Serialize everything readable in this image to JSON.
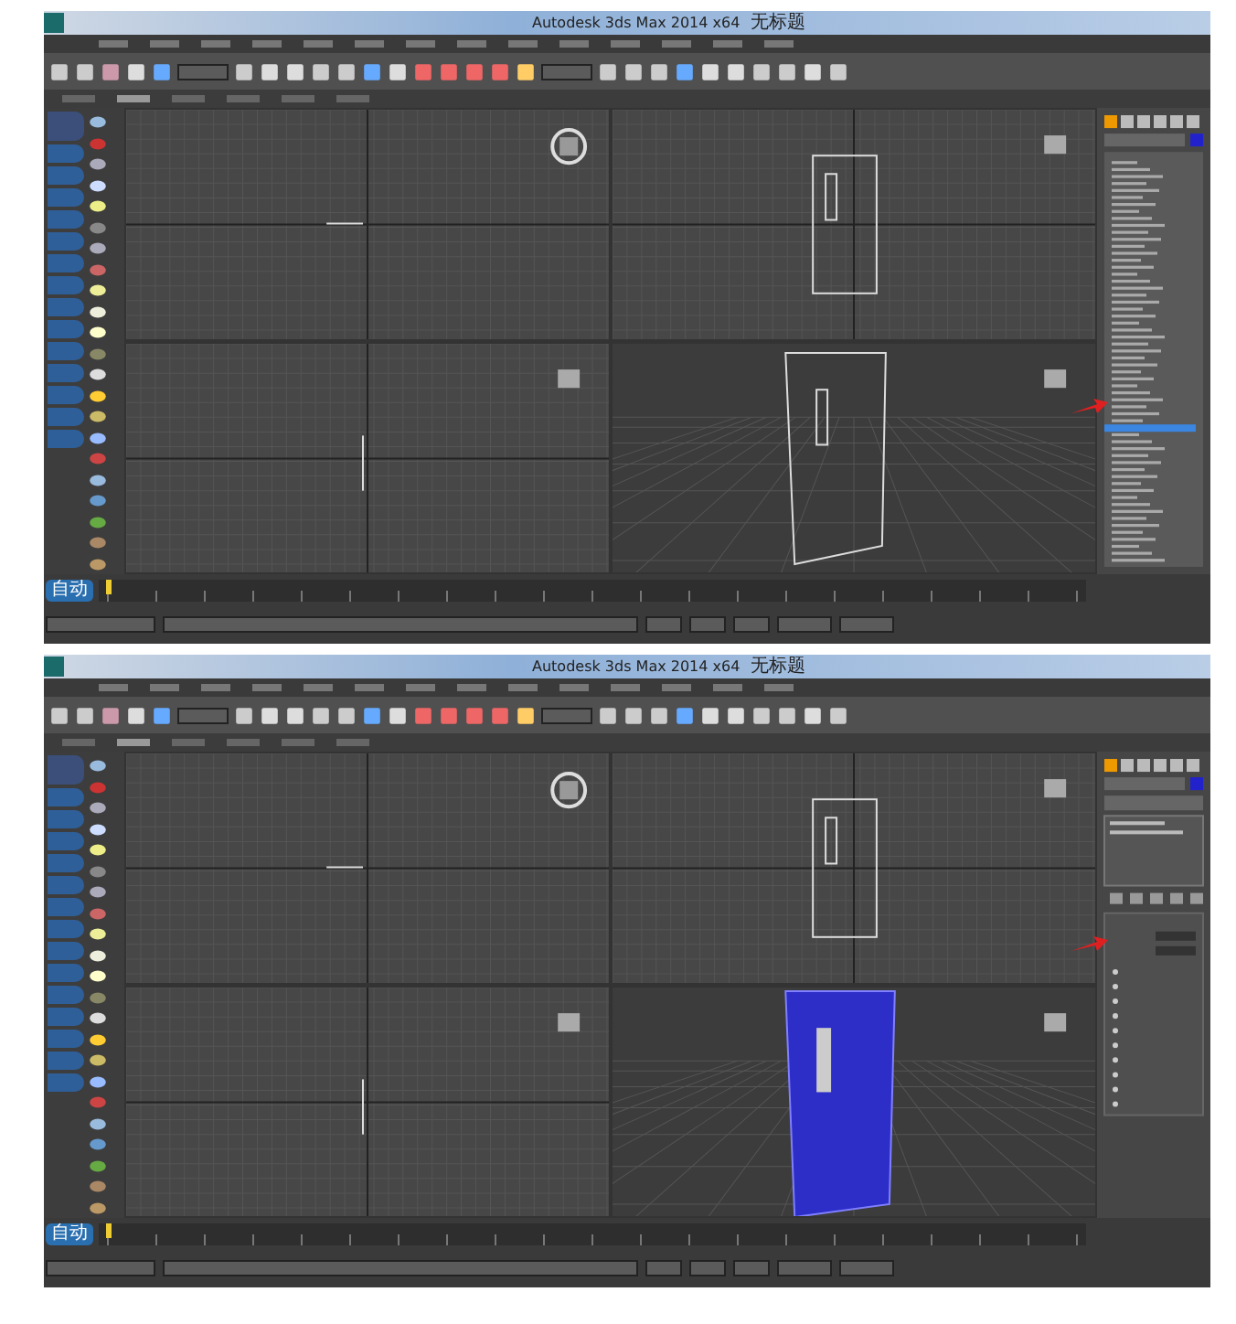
{
  "screenshots": [
    {
      "window": {
        "title": "Autodesk 3ds Max 2014 x64",
        "document": "无标题"
      },
      "viewports": [
        {
          "kind": "top",
          "object": {
            "kind": "line"
          }
        },
        {
          "kind": "side",
          "object": {
            "kind": "wire"
          }
        },
        {
          "kind": "side",
          "object": {
            "kind": "line"
          }
        },
        {
          "kind": "perspective",
          "object": {
            "kind": "wire"
          }
        }
      ],
      "command_panel": {
        "kind": "modifier_list",
        "callout": true
      },
      "auto_key_button": "自动"
    },
    {
      "window": {
        "title": "Autodesk 3ds Max 2014 x64",
        "document": "无标题"
      },
      "viewports": [
        {
          "kind": "top",
          "object": {
            "kind": "line"
          }
        },
        {
          "kind": "side",
          "object": {
            "kind": "wire"
          }
        },
        {
          "kind": "side",
          "object": {
            "kind": "line"
          }
        },
        {
          "kind": "perspective",
          "object": {
            "kind": "shaded"
          }
        }
      ],
      "command_panel": {
        "kind": "parameters",
        "callout": true
      },
      "auto_key_button": "自动"
    }
  ]
}
